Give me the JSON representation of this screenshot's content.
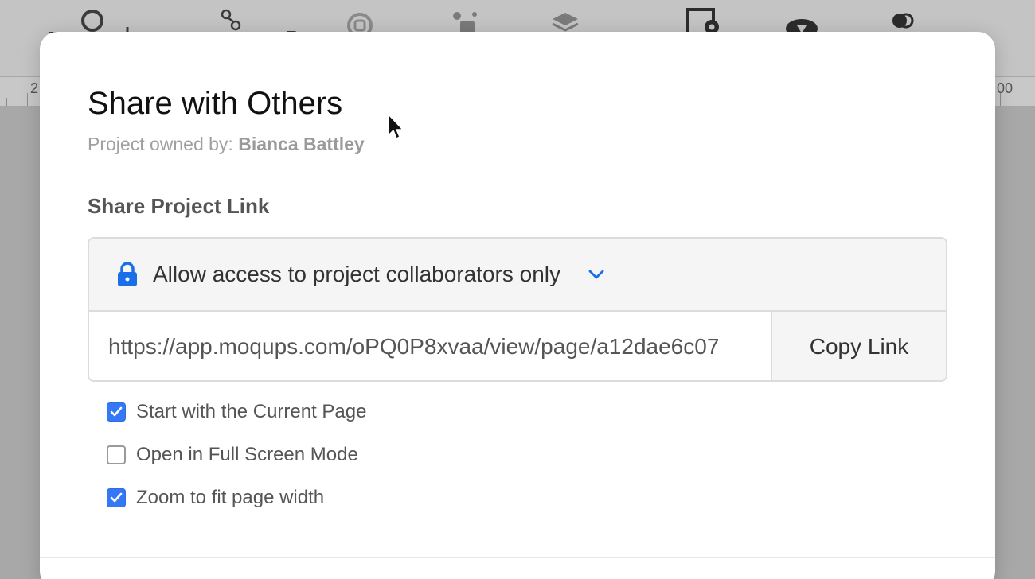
{
  "background": {
    "ruler": {
      "left_label": "2",
      "right_label": "00"
    }
  },
  "modal": {
    "title": "Share with Others",
    "owner_prefix": "Project owned by:",
    "owner_name": "Bianca Battley",
    "section_heading": "Share Project Link",
    "access": {
      "icon": "lock-icon",
      "label": "Allow access to project collaborators only",
      "chevron": "chevron-down-icon"
    },
    "link": {
      "url": "https://app.moqups.com/oPQ0P8xvaa/view/page/a12dae6c07",
      "copy_label": "Copy Link"
    },
    "options": [
      {
        "label": "Start with the Current Page",
        "checked": true
      },
      {
        "label": "Open in Full Screen Mode",
        "checked": false
      },
      {
        "label": "Zoom to fit page width",
        "checked": true
      }
    ]
  },
  "colors": {
    "accent": "#3478f6",
    "lock": "#1a6fe8",
    "overlay": "#a9a9a9"
  }
}
